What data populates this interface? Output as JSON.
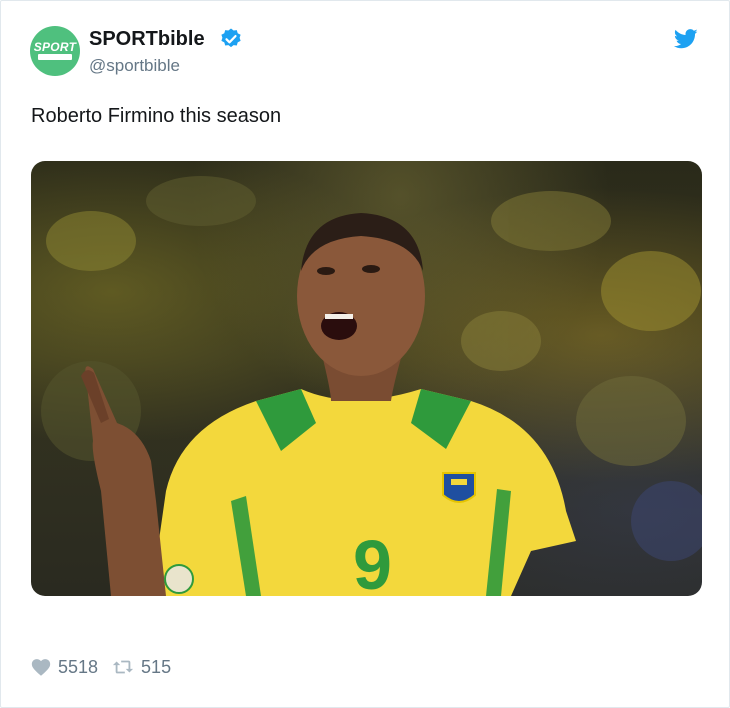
{
  "account": {
    "display_name": "SPORTbible",
    "handle": "@sportbible",
    "avatar_text": "SPORT",
    "verified": true
  },
  "tweet": {
    "text": "Roberto Firmino this season",
    "media": {
      "description": "photo-of-footballer-in-yellow-brazil-kit-pointing-up",
      "jersey_number": "9"
    }
  },
  "stats": {
    "likes": "5518",
    "retweets": "515"
  },
  "icons": {
    "bird": "twitter-bird-icon",
    "verified": "verified-badge-icon",
    "like": "heart-icon",
    "retweet": "retweet-icon"
  },
  "colors": {
    "brand_blue": "#1da1f2",
    "avatar_green": "#4fc07e",
    "muted_text": "#657786",
    "kit_yellow": "#f3d83c",
    "kit_green": "#2f9a3c"
  }
}
